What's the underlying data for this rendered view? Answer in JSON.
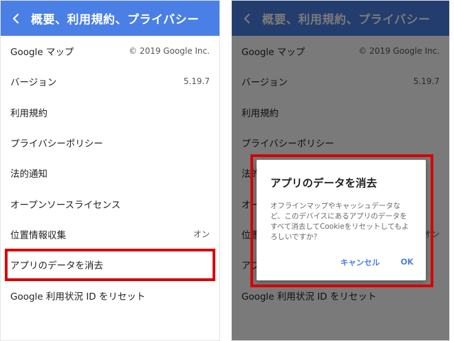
{
  "colors": {
    "accent": "#4a7fe6",
    "accent_dimmed": "#2c4c8a",
    "highlight": "#d90000"
  },
  "header": {
    "title": "概要、利用規約、プライバシー",
    "back_icon": "back-arrow-icon"
  },
  "settings": [
    {
      "label": "Google マップ",
      "value": "© 2019 Google Inc."
    },
    {
      "label": "バージョン",
      "value": "5.19.7"
    },
    {
      "label": "利用規約",
      "value": ""
    },
    {
      "label": "プライバシーポリシー",
      "value": ""
    },
    {
      "label": "法的通知",
      "value": ""
    },
    {
      "label": "オープンソースライセンス",
      "value": ""
    },
    {
      "label": "位置情報収集",
      "value": "オン"
    },
    {
      "label": "アプリのデータを消去",
      "value": ""
    },
    {
      "label": "Google 利用状況 ID をリセット",
      "value": ""
    }
  ],
  "dialog": {
    "title": "アプリのデータを消去",
    "message": "オフラインマップやキャッシュデータなど、このデバイスにあるアプリのデータをすべて消去してCookieをリセットしてもよろしいですか？",
    "cancel_label": "キャンセル",
    "ok_label": "OK"
  }
}
